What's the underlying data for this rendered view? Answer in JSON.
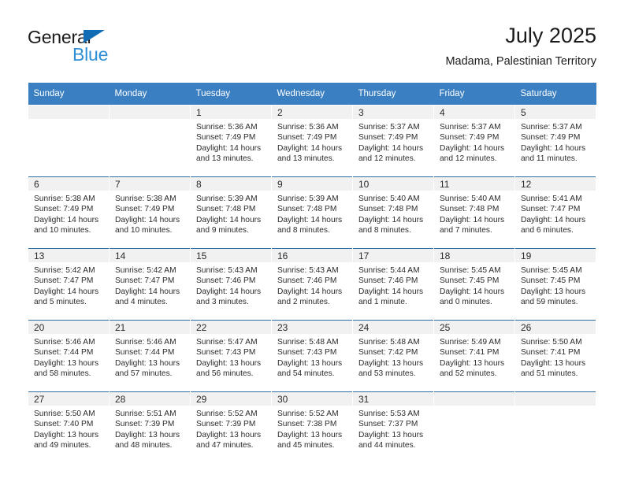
{
  "brand": {
    "name_top": "General",
    "name_bottom": "Blue",
    "triangle_color": "#0f6cb5",
    "blue_color": "#2e8fd6"
  },
  "header": {
    "title": "July 2025",
    "subtitle": "Madama, Palestinian Territory"
  },
  "theme": {
    "header_row_bg": "#3a7fc1",
    "header_row_text": "#ffffff",
    "daynum_band_bg": "#f1f1f1",
    "row_divider": "#2e6ca4",
    "body_text": "#2b2b2b"
  },
  "weekday_headers": [
    "Sunday",
    "Monday",
    "Tuesday",
    "Wednesday",
    "Thursday",
    "Friday",
    "Saturday"
  ],
  "weeks": [
    [
      {
        "day": "",
        "sunrise": "",
        "sunset": "",
        "daylight_line1": "",
        "daylight_line2": ""
      },
      {
        "day": "",
        "sunrise": "",
        "sunset": "",
        "daylight_line1": "",
        "daylight_line2": ""
      },
      {
        "day": "1",
        "sunrise": "Sunrise: 5:36 AM",
        "sunset": "Sunset: 7:49 PM",
        "daylight_line1": "Daylight: 14 hours",
        "daylight_line2": "and 13 minutes."
      },
      {
        "day": "2",
        "sunrise": "Sunrise: 5:36 AM",
        "sunset": "Sunset: 7:49 PM",
        "daylight_line1": "Daylight: 14 hours",
        "daylight_line2": "and 13 minutes."
      },
      {
        "day": "3",
        "sunrise": "Sunrise: 5:37 AM",
        "sunset": "Sunset: 7:49 PM",
        "daylight_line1": "Daylight: 14 hours",
        "daylight_line2": "and 12 minutes."
      },
      {
        "day": "4",
        "sunrise": "Sunrise: 5:37 AM",
        "sunset": "Sunset: 7:49 PM",
        "daylight_line1": "Daylight: 14 hours",
        "daylight_line2": "and 12 minutes."
      },
      {
        "day": "5",
        "sunrise": "Sunrise: 5:37 AM",
        "sunset": "Sunset: 7:49 PM",
        "daylight_line1": "Daylight: 14 hours",
        "daylight_line2": "and 11 minutes."
      }
    ],
    [
      {
        "day": "6",
        "sunrise": "Sunrise: 5:38 AM",
        "sunset": "Sunset: 7:49 PM",
        "daylight_line1": "Daylight: 14 hours",
        "daylight_line2": "and 10 minutes."
      },
      {
        "day": "7",
        "sunrise": "Sunrise: 5:38 AM",
        "sunset": "Sunset: 7:49 PM",
        "daylight_line1": "Daylight: 14 hours",
        "daylight_line2": "and 10 minutes."
      },
      {
        "day": "8",
        "sunrise": "Sunrise: 5:39 AM",
        "sunset": "Sunset: 7:48 PM",
        "daylight_line1": "Daylight: 14 hours",
        "daylight_line2": "and 9 minutes."
      },
      {
        "day": "9",
        "sunrise": "Sunrise: 5:39 AM",
        "sunset": "Sunset: 7:48 PM",
        "daylight_line1": "Daylight: 14 hours",
        "daylight_line2": "and 8 minutes."
      },
      {
        "day": "10",
        "sunrise": "Sunrise: 5:40 AM",
        "sunset": "Sunset: 7:48 PM",
        "daylight_line1": "Daylight: 14 hours",
        "daylight_line2": "and 8 minutes."
      },
      {
        "day": "11",
        "sunrise": "Sunrise: 5:40 AM",
        "sunset": "Sunset: 7:48 PM",
        "daylight_line1": "Daylight: 14 hours",
        "daylight_line2": "and 7 minutes."
      },
      {
        "day": "12",
        "sunrise": "Sunrise: 5:41 AM",
        "sunset": "Sunset: 7:47 PM",
        "daylight_line1": "Daylight: 14 hours",
        "daylight_line2": "and 6 minutes."
      }
    ],
    [
      {
        "day": "13",
        "sunrise": "Sunrise: 5:42 AM",
        "sunset": "Sunset: 7:47 PM",
        "daylight_line1": "Daylight: 14 hours",
        "daylight_line2": "and 5 minutes."
      },
      {
        "day": "14",
        "sunrise": "Sunrise: 5:42 AM",
        "sunset": "Sunset: 7:47 PM",
        "daylight_line1": "Daylight: 14 hours",
        "daylight_line2": "and 4 minutes."
      },
      {
        "day": "15",
        "sunrise": "Sunrise: 5:43 AM",
        "sunset": "Sunset: 7:46 PM",
        "daylight_line1": "Daylight: 14 hours",
        "daylight_line2": "and 3 minutes."
      },
      {
        "day": "16",
        "sunrise": "Sunrise: 5:43 AM",
        "sunset": "Sunset: 7:46 PM",
        "daylight_line1": "Daylight: 14 hours",
        "daylight_line2": "and 2 minutes."
      },
      {
        "day": "17",
        "sunrise": "Sunrise: 5:44 AM",
        "sunset": "Sunset: 7:46 PM",
        "daylight_line1": "Daylight: 14 hours",
        "daylight_line2": "and 1 minute."
      },
      {
        "day": "18",
        "sunrise": "Sunrise: 5:45 AM",
        "sunset": "Sunset: 7:45 PM",
        "daylight_line1": "Daylight: 14 hours",
        "daylight_line2": "and 0 minutes."
      },
      {
        "day": "19",
        "sunrise": "Sunrise: 5:45 AM",
        "sunset": "Sunset: 7:45 PM",
        "daylight_line1": "Daylight: 13 hours",
        "daylight_line2": "and 59 minutes."
      }
    ],
    [
      {
        "day": "20",
        "sunrise": "Sunrise: 5:46 AM",
        "sunset": "Sunset: 7:44 PM",
        "daylight_line1": "Daylight: 13 hours",
        "daylight_line2": "and 58 minutes."
      },
      {
        "day": "21",
        "sunrise": "Sunrise: 5:46 AM",
        "sunset": "Sunset: 7:44 PM",
        "daylight_line1": "Daylight: 13 hours",
        "daylight_line2": "and 57 minutes."
      },
      {
        "day": "22",
        "sunrise": "Sunrise: 5:47 AM",
        "sunset": "Sunset: 7:43 PM",
        "daylight_line1": "Daylight: 13 hours",
        "daylight_line2": "and 56 minutes."
      },
      {
        "day": "23",
        "sunrise": "Sunrise: 5:48 AM",
        "sunset": "Sunset: 7:43 PM",
        "daylight_line1": "Daylight: 13 hours",
        "daylight_line2": "and 54 minutes."
      },
      {
        "day": "24",
        "sunrise": "Sunrise: 5:48 AM",
        "sunset": "Sunset: 7:42 PM",
        "daylight_line1": "Daylight: 13 hours",
        "daylight_line2": "and 53 minutes."
      },
      {
        "day": "25",
        "sunrise": "Sunrise: 5:49 AM",
        "sunset": "Sunset: 7:41 PM",
        "daylight_line1": "Daylight: 13 hours",
        "daylight_line2": "and 52 minutes."
      },
      {
        "day": "26",
        "sunrise": "Sunrise: 5:50 AM",
        "sunset": "Sunset: 7:41 PM",
        "daylight_line1": "Daylight: 13 hours",
        "daylight_line2": "and 51 minutes."
      }
    ],
    [
      {
        "day": "27",
        "sunrise": "Sunrise: 5:50 AM",
        "sunset": "Sunset: 7:40 PM",
        "daylight_line1": "Daylight: 13 hours",
        "daylight_line2": "and 49 minutes."
      },
      {
        "day": "28",
        "sunrise": "Sunrise: 5:51 AM",
        "sunset": "Sunset: 7:39 PM",
        "daylight_line1": "Daylight: 13 hours",
        "daylight_line2": "and 48 minutes."
      },
      {
        "day": "29",
        "sunrise": "Sunrise: 5:52 AM",
        "sunset": "Sunset: 7:39 PM",
        "daylight_line1": "Daylight: 13 hours",
        "daylight_line2": "and 47 minutes."
      },
      {
        "day": "30",
        "sunrise": "Sunrise: 5:52 AM",
        "sunset": "Sunset: 7:38 PM",
        "daylight_line1": "Daylight: 13 hours",
        "daylight_line2": "and 45 minutes."
      },
      {
        "day": "31",
        "sunrise": "Sunrise: 5:53 AM",
        "sunset": "Sunset: 7:37 PM",
        "daylight_line1": "Daylight: 13 hours",
        "daylight_line2": "and 44 minutes."
      },
      {
        "day": "",
        "sunrise": "",
        "sunset": "",
        "daylight_line1": "",
        "daylight_line2": ""
      },
      {
        "day": "",
        "sunrise": "",
        "sunset": "",
        "daylight_line1": "",
        "daylight_line2": ""
      }
    ]
  ]
}
